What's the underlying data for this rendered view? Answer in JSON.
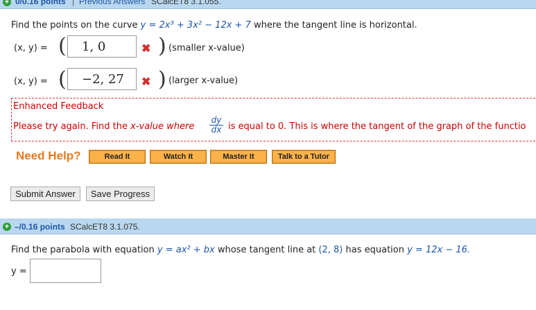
{
  "prev_question": {
    "points": "0/0.16 points",
    "separator": "|",
    "prev_answers": "Previous Answers",
    "source": "SCalcET8 3.1.055."
  },
  "question1": {
    "prompt_prefix": "Find the points on the curve",
    "equation": "y = 2x³ + 3x² − 12x + 7",
    "prompt_suffix": "where the tangent line is horizontal.",
    "row1": {
      "label": "(x, y) =",
      "answer": "1, 0",
      "note": "(smaller x-value)"
    },
    "row2": {
      "label": "(x, y) =",
      "answer": "−2, 27",
      "note": "(larger x-value)"
    },
    "wrong_mark": "✖"
  },
  "feedback": {
    "title": "Enhanced Feedback",
    "text_a": "Please try again. Find the",
    "text_b": "x-value where",
    "frac_num": "dy",
    "frac_den": "dx",
    "text_c": "is equal to 0. This is where the tangent of the graph of the functio"
  },
  "help": {
    "label": "Need Help?",
    "buttons": [
      "Read It",
      "Watch It",
      "Master It",
      "Talk to a Tutor"
    ]
  },
  "actions": {
    "submit": "Submit Answer",
    "save": "Save Progress"
  },
  "next_question": {
    "points": "–/0.16 points",
    "source": "SCalcET8 3.1.075.",
    "prompt_prefix": "Find the parabola with equation",
    "equation": "y = ax² + bx",
    "prompt_mid": "whose tangent line at",
    "point": "(2, 8)",
    "prompt_mid2": "has equation",
    "tangent_eq": "y = 12x − 16.",
    "answer_label": "y =",
    "answer_value": ""
  },
  "colors": {
    "header_bg": "#b9d8ef",
    "points": "#1f55a8",
    "feedback": "#cc0000",
    "help_button": "#f39c28",
    "wrong": "#d32f2f"
  }
}
